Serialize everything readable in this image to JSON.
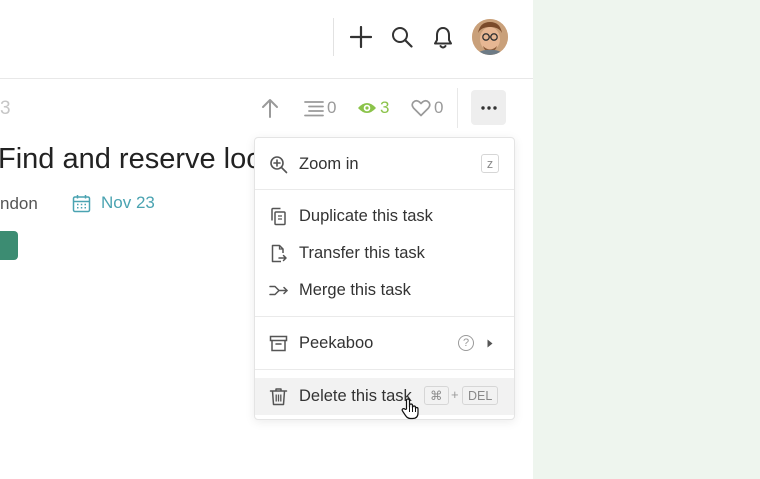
{
  "task": {
    "id_fragment": "3",
    "title": "Find and reserve loca",
    "assignee_fragment": "ndon",
    "due_date": "Nov 23"
  },
  "toolbar": {
    "subtasks_count": "0",
    "watchers_count": "3",
    "likes_count": "0"
  },
  "menu": {
    "items": [
      {
        "label": "Zoom in",
        "shortcut": "z"
      },
      {
        "label": "Duplicate this task"
      },
      {
        "label": "Transfer this task"
      },
      {
        "label": "Merge this task"
      },
      {
        "label": "Peekaboo",
        "help": "?"
      },
      {
        "label": "Delete this task",
        "shortcut_mod": "⌘",
        "shortcut_plus": "+",
        "shortcut_key": "DEL"
      }
    ]
  },
  "icons": {
    "topbar": [
      "plus-icon",
      "search-icon",
      "bell-icon",
      "avatar"
    ],
    "toolbar": [
      "arrow-up-icon",
      "subtasks-icon",
      "eye-icon",
      "heart-icon",
      "more-icon"
    ],
    "menu": [
      "zoom-in-icon",
      "duplicate-icon",
      "transfer-icon",
      "merge-icon",
      "archive-icon",
      "help-icon",
      "chevron-right-icon",
      "trash-icon",
      "hand-cursor-icon"
    ]
  },
  "colors": {
    "accent_date": "#4aa3b1",
    "watchers_green": "#8bc34a",
    "tag": "#3c8c72",
    "right_pane": "#eef5ee"
  }
}
